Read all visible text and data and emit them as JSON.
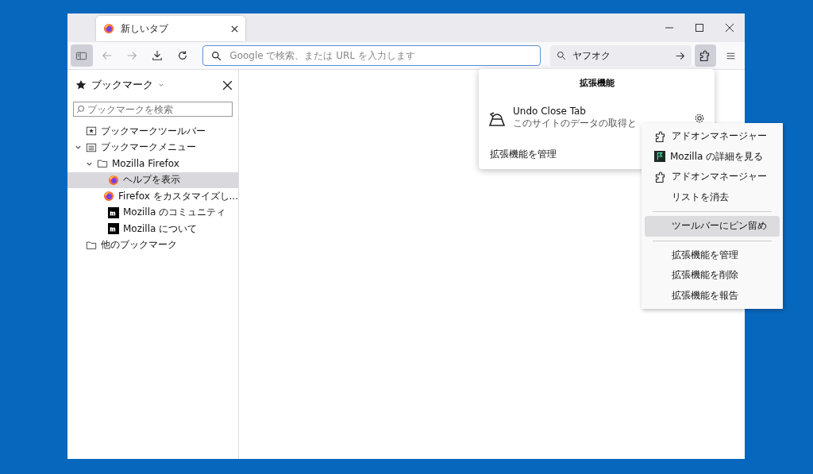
{
  "tabs": [
    {
      "title": "新しいタブ",
      "selected": true
    }
  ],
  "toolbar": {
    "sidebar_toggle_on": true,
    "url_placeholder": "Google で検索、または URL を入力します",
    "search_value": "ヤフオク",
    "extensions_on": true
  },
  "sidebar": {
    "title": "ブックマーク",
    "search_placeholder": "ブックマークを検索",
    "tree": [
      {
        "label": "ブックマークツールバー",
        "kind": "toolbar",
        "selected": false
      },
      {
        "label": "ブックマークメニュー",
        "kind": "menu",
        "selected": false,
        "expanded": true,
        "children": [
          {
            "label": "Mozilla Firefox",
            "kind": "folder",
            "selected": false,
            "expanded": true,
            "children": [
              {
                "label": "ヘルプを表示",
                "kind": "firefox",
                "selected": true
              },
              {
                "label": "Firefox をカスタマイズし...",
                "kind": "firefox",
                "selected": false
              },
              {
                "label": "Mozilla のコミュニティ",
                "kind": "mozilla",
                "selected": false
              },
              {
                "label": "Mozilla について",
                "kind": "mozilla",
                "selected": false
              }
            ]
          }
        ]
      },
      {
        "label": "他のブックマーク",
        "kind": "folder",
        "selected": false
      }
    ]
  },
  "extensions_panel": {
    "title": "拡張機能",
    "extension": {
      "name": "Undo Close Tab",
      "description": "このサイトのデータの取得と"
    },
    "manage": "拡張機能を管理"
  },
  "context_menu": {
    "groups": [
      [
        {
          "label": "アドオンマネージャー",
          "kind": "puzzle",
          "selected": false
        },
        {
          "label": "Mozilla の詳細を見る",
          "kind": "flag",
          "selected": false
        },
        {
          "label": "アドオンマネージャー",
          "kind": "puzzle",
          "selected": false
        },
        {
          "label": "リストを消去",
          "kind": "plain",
          "selected": false
        }
      ],
      [
        {
          "label": "ツールバーにピン留め",
          "kind": "plain",
          "selected": true
        }
      ],
      [
        {
          "label": "拡張機能を管理",
          "kind": "plain",
          "selected": false
        },
        {
          "label": "拡張機能を削除",
          "kind": "plain",
          "selected": false
        },
        {
          "label": "拡張機能を報告",
          "kind": "plain",
          "selected": false
        }
      ]
    ]
  }
}
